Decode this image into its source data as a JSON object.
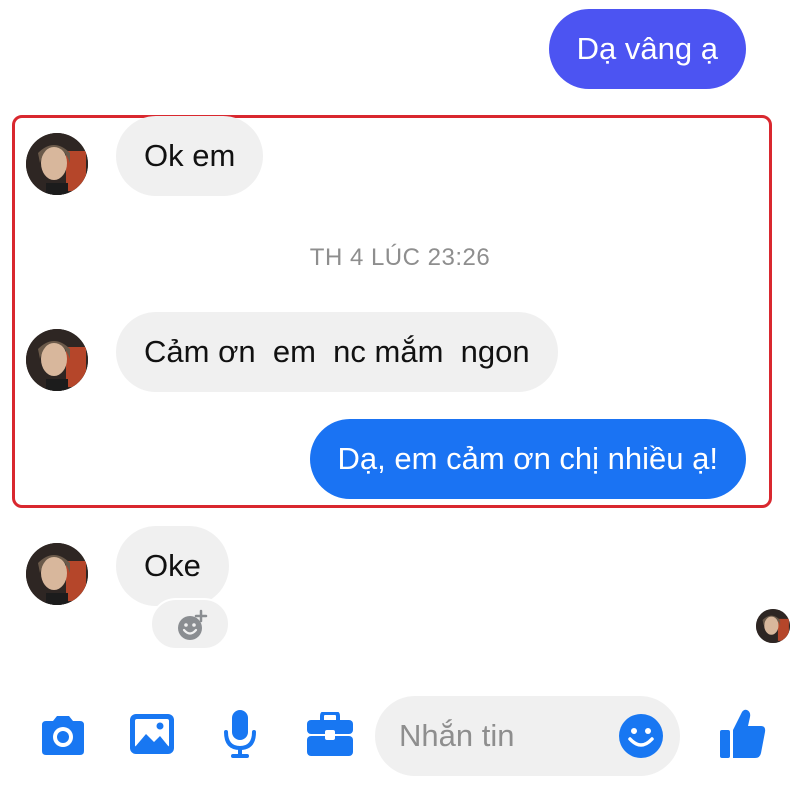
{
  "messages": [
    {
      "text": "Dạ vâng ạ",
      "direction": "outgoing"
    },
    {
      "text": "Ok em",
      "direction": "incoming"
    },
    {
      "text": "Cảm ơn  em  nc mắm  ngon",
      "direction": "incoming"
    },
    {
      "text": "Dạ, em cảm ơn chị nhiều ạ!",
      "direction": "outgoing"
    },
    {
      "text": "Oke",
      "direction": "incoming"
    }
  ],
  "timestamp": "TH 4 LÚC 23:26",
  "composer": {
    "placeholder": "Nhắn tin"
  },
  "toolbar_icons": [
    "camera-icon",
    "image-icon",
    "microphone-icon",
    "briefcase-icon",
    "emoji-icon",
    "thumbs-up-icon"
  ],
  "colors": {
    "accent": "#1a73f3",
    "outgoing_purple": "#4c54f2",
    "incoming_bubble": "#f0f0f0",
    "highlight": "#d9282f",
    "icon_blue": "#1877f2"
  }
}
